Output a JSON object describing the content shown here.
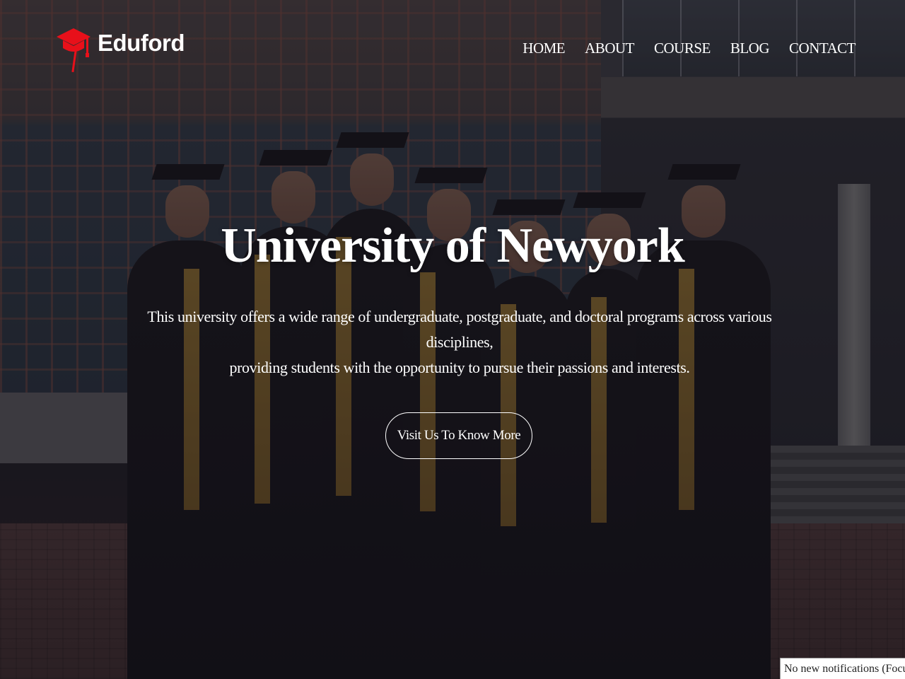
{
  "header": {
    "logo_text": "Eduford",
    "logo_icon": "graduation-cap-icon",
    "brand_color": "#e8101a"
  },
  "nav": {
    "items": [
      {
        "label": "HOME"
      },
      {
        "label": "ABOUT"
      },
      {
        "label": "COURSE"
      },
      {
        "label": "BLOG"
      },
      {
        "label": "CONTACT"
      }
    ]
  },
  "hero": {
    "title": "University of Newyork",
    "description_line1": "This university offers a wide range of undergraduate, postgraduate, and doctoral programs across various disciplines,",
    "description_line2": "providing students with the opportunity to pursue their passions and interests.",
    "cta_label": "Visit Us To Know More"
  },
  "notification": {
    "text": "No new notifications (Focus assi"
  }
}
